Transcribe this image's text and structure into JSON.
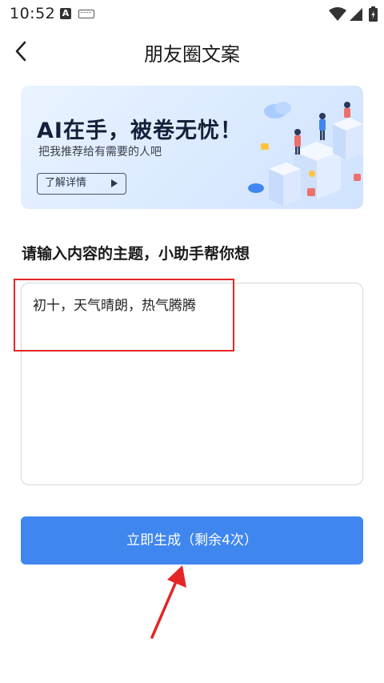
{
  "status_bar": {
    "time": "10:52",
    "icons": [
      "a-notification-icon",
      "keyboard-icon",
      "wifi-icon",
      "signal-icon",
      "battery-icon"
    ]
  },
  "header": {
    "title": "朋友圈文案",
    "back_icon": "chevron-left-icon"
  },
  "banner": {
    "title": "AI在手，被卷无忧！",
    "subtitle": "把我推荐给有需要的人吧",
    "button_label": "了解详情"
  },
  "form": {
    "label": "请输入内容的主题，小助手帮你想",
    "input_value": "初十，天气晴朗，热气腾腾",
    "submit_label": "立即生成（剩余4次）"
  },
  "colors": {
    "accent": "#3f86ef",
    "annotation": "#e32626",
    "banner_bg": "#dbeaff"
  }
}
